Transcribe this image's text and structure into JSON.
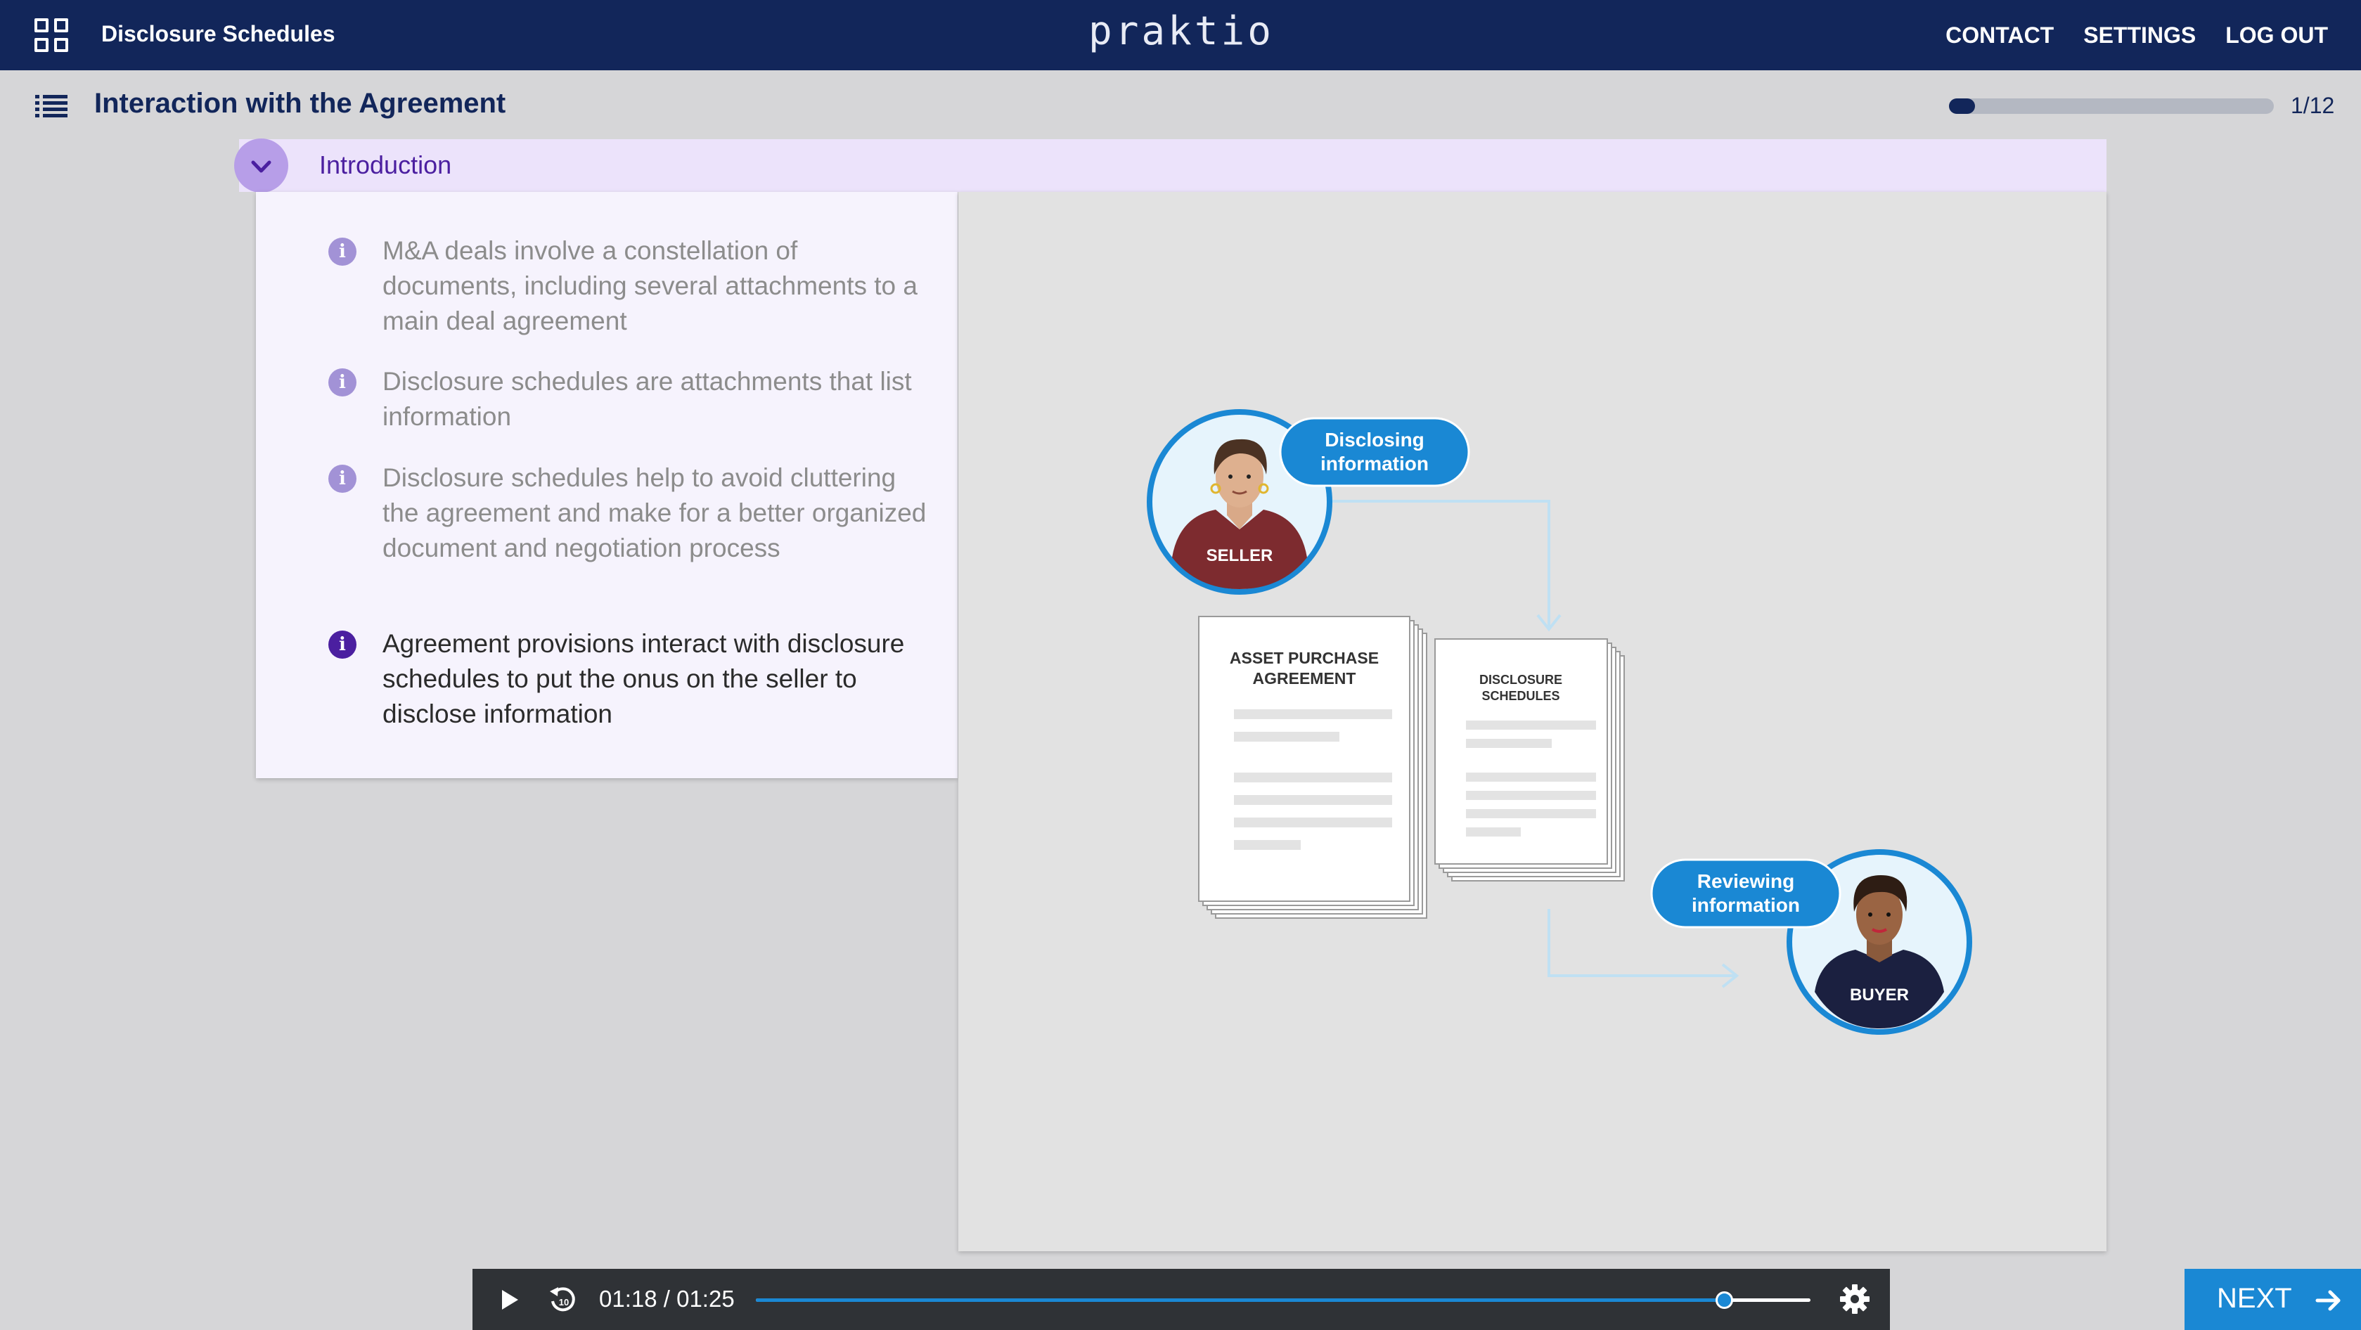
{
  "header": {
    "course_title": "Disclosure Schedules",
    "brand": "praktio",
    "nav": [
      "CONTACT",
      "SETTINGS",
      "LOG OUT"
    ]
  },
  "lesson": {
    "title": "Interaction with the Agreement",
    "progress_text": "1/12",
    "progress_fraction": 0.08
  },
  "section": {
    "title": "Introduction",
    "bullets": [
      {
        "text": "M&A deals involve a constellation of documents, including several attachments to a main deal agreement",
        "current": false
      },
      {
        "text": "Disclosure schedules are attachments that list information",
        "current": false
      },
      {
        "text": "Disclosure schedules help to avoid cluttering the agreement and make for a better organized document and negotiation process",
        "current": false
      },
      {
        "text": "Agreement provisions interact with disclosure schedules to put the onus on the seller to disclose information",
        "current": true
      }
    ],
    "bullet_icon": "info-icon"
  },
  "illustration": {
    "seller_label": "SELLER",
    "seller_bubble": [
      "Disclosing",
      "information"
    ],
    "buyer_label": "BUYER",
    "buyer_bubble": [
      "Reviewing",
      "information"
    ],
    "doc1_title": [
      "ASSET PURCHASE",
      "AGREEMENT"
    ],
    "doc2_title": [
      "DISCLOSURE",
      "SCHEDULES"
    ]
  },
  "player": {
    "time": "01:18 / 01:25",
    "played_fraction": 0.918,
    "icons": [
      "play-icon",
      "replay-10-icon",
      "settings-gear-icon"
    ]
  },
  "next_label": "NEXT",
  "colors": {
    "navy": "#12265a",
    "purple": "#4b1fa0",
    "lavender": "#ece3fb",
    "blue": "#1a88d4",
    "player_bg": "#2f3236"
  }
}
